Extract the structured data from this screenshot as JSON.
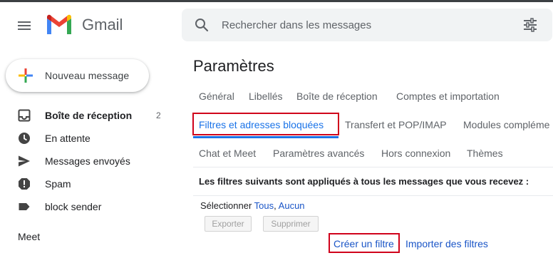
{
  "app": {
    "name": "Gmail"
  },
  "search": {
    "placeholder": "Rechercher dans les messages"
  },
  "compose": {
    "label": "Nouveau message"
  },
  "sidebar": {
    "items": [
      {
        "label": "Boîte de réception",
        "count": "2",
        "bold": true
      },
      {
        "label": "En attente"
      },
      {
        "label": "Messages envoyés"
      },
      {
        "label": "Spam"
      },
      {
        "label": "block sender"
      }
    ],
    "meet_heading": "Meet"
  },
  "settings": {
    "title": "Paramètres",
    "tabs_row1": [
      "Général",
      "Libellés",
      "Boîte de réception",
      "Comptes et importation"
    ],
    "tabs_row2": [
      "Filtres et adresses bloquées",
      "Transfert et POP/IMAP",
      "Modules compléme"
    ],
    "tabs_row3": [
      "Chat et Meet",
      "Paramètres avancés",
      "Hors connexion",
      "Thèmes"
    ],
    "active_tab": "Filtres et adresses bloquées",
    "description": "Les filtres suivants sont appliqués à tous les messages que vous recevez :",
    "select_label": "Sélectionner",
    "select_all": "Tous",
    "select_sep": ",",
    "select_none": "Aucun",
    "export_button": "Exporter",
    "delete_button": "Supprimer",
    "create_filter": "Créer un filtre",
    "import_filters": "Importer des filtres"
  },
  "colors": {
    "accent": "#1a73e8",
    "highlight_box": "#d0021b",
    "link": "#1a55c7"
  }
}
